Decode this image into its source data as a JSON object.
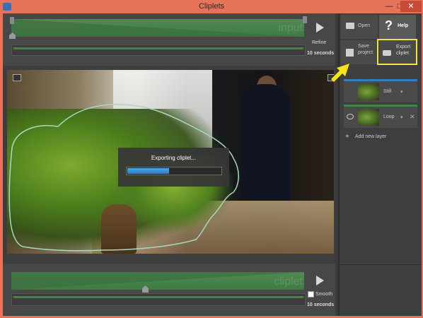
{
  "window": {
    "title": "Cliplets",
    "minimize_glyph": "—",
    "maximize_glyph": "□",
    "close_glyph": "✕"
  },
  "top_timeline": {
    "watermark": "input",
    "refine_label": "Refine",
    "duration": "10 seconds"
  },
  "bottom_timeline": {
    "watermark": "cliplet",
    "smooth_label": "Smooth",
    "smooth_checked": false,
    "duration": "10 seconds"
  },
  "export_dialog": {
    "text": "Exporting cliplet...",
    "progress_percent": 45
  },
  "toolbar": {
    "open_label": "Open",
    "help_label": "Help",
    "help_glyph": "?",
    "save_label": "Save project",
    "export_label": "Export cliplet"
  },
  "layers": [
    {
      "label": "Still",
      "dropdown_glyph": "▾"
    },
    {
      "label": "Loop",
      "dropdown_glyph": "▾",
      "remove_glyph": "✕"
    }
  ],
  "add_layer": {
    "label": "Add new layer",
    "glyph": "+"
  },
  "colors": {
    "accent_green": "#3f8548",
    "progress_blue": "#1f7fc8",
    "highlight_yellow": "#f2e23a",
    "titlebar": "#e6735a"
  }
}
